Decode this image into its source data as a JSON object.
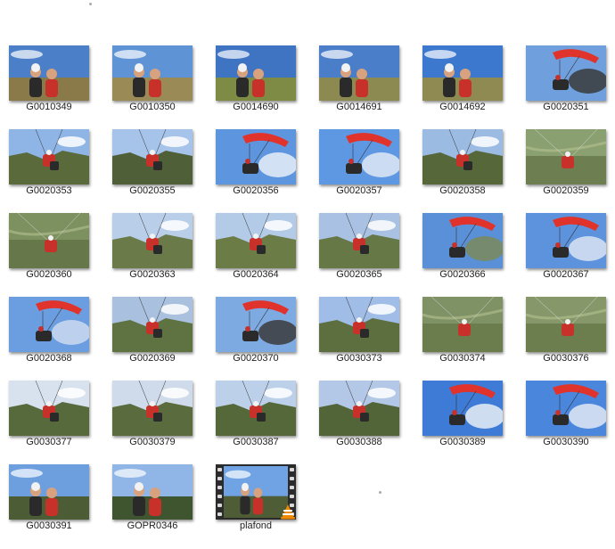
{
  "explorer": {
    "files": [
      {
        "name": "G0010349",
        "type": "image",
        "sky": "#4b7fc7",
        "ground": "#8a7a4a",
        "canopy": false,
        "scene": "people"
      },
      {
        "name": "G0010350",
        "type": "image",
        "sky": "#5e93d6",
        "ground": "#9a8a55",
        "canopy": false,
        "scene": "people"
      },
      {
        "name": "G0014690",
        "type": "image",
        "sky": "#3f74c2",
        "ground": "#7d8b45",
        "canopy": false,
        "scene": "people"
      },
      {
        "name": "G0014691",
        "type": "image",
        "sky": "#4a7ec8",
        "ground": "#8c8a50",
        "canopy": false,
        "scene": "people"
      },
      {
        "name": "G0014692",
        "type": "image",
        "sky": "#3d78cf",
        "ground": "#8f8a52",
        "canopy": false,
        "scene": "people"
      },
      {
        "name": "G0020351",
        "type": "image",
        "sky": "#6fa0dd",
        "ground": "#3a3a3a",
        "canopy": true,
        "scene": "canopy"
      },
      {
        "name": "G0020353",
        "type": "image",
        "sky": "#8fb5e6",
        "ground": "#5a6a3a",
        "canopy": false,
        "scene": "flight"
      },
      {
        "name": "G0020355",
        "type": "image",
        "sky": "#a6c4ea",
        "ground": "#4f5f38",
        "canopy": false,
        "scene": "flight"
      },
      {
        "name": "G0020356",
        "type": "image",
        "sky": "#5d95df",
        "ground": "#e8eef8",
        "canopy": true,
        "scene": "canopy"
      },
      {
        "name": "G0020357",
        "type": "image",
        "sky": "#5f98e2",
        "ground": "#dfe7f4",
        "canopy": true,
        "scene": "canopy"
      },
      {
        "name": "G0020358",
        "type": "image",
        "sky": "#9bbbe3",
        "ground": "#56673a",
        "canopy": false,
        "scene": "flight"
      },
      {
        "name": "G0020359",
        "type": "image",
        "sky": "#8aa070",
        "ground": "#6d7f50",
        "canopy": false,
        "scene": "valley"
      },
      {
        "name": "G0020360",
        "type": "image",
        "sky": "#7c9060",
        "ground": "#66784a",
        "canopy": false,
        "scene": "valley"
      },
      {
        "name": "G0020363",
        "type": "image",
        "sky": "#b9cfe9",
        "ground": "#6a7a48",
        "canopy": false,
        "scene": "flight"
      },
      {
        "name": "G0020364",
        "type": "image",
        "sky": "#b4cbe7",
        "ground": "#6b7c47",
        "canopy": false,
        "scene": "flight"
      },
      {
        "name": "G0020365",
        "type": "image",
        "sky": "#a9c2e4",
        "ground": "#657845",
        "canopy": false,
        "scene": "flight"
      },
      {
        "name": "G0020366",
        "type": "image",
        "sky": "#5a90d8",
        "ground": "#7b8a5a",
        "canopy": true,
        "scene": "canopy"
      },
      {
        "name": "G0020367",
        "type": "image",
        "sky": "#5c93dc",
        "ground": "#d9e3f2",
        "canopy": true,
        "scene": "canopy"
      },
      {
        "name": "G0020368",
        "type": "image",
        "sky": "#6a9ee0",
        "ground": "#cbd8ee",
        "canopy": true,
        "scene": "canopy"
      },
      {
        "name": "G0020369",
        "type": "image",
        "sky": "#a9c1df",
        "ground": "#5e7242",
        "canopy": false,
        "scene": "flight"
      },
      {
        "name": "G0020370",
        "type": "image",
        "sky": "#7eaae2",
        "ground": "#3b3b3b",
        "canopy": true,
        "scene": "canopy"
      },
      {
        "name": "G0030373",
        "type": "image",
        "sky": "#9fbde6",
        "ground": "#5d6e3f",
        "canopy": false,
        "scene": "flight"
      },
      {
        "name": "G0030374",
        "type": "image",
        "sky": "#7f9265",
        "ground": "#6b7d4d",
        "canopy": false,
        "scene": "valley"
      },
      {
        "name": "G0030376",
        "type": "image",
        "sky": "#86986a",
        "ground": "#6c7e4e",
        "canopy": false,
        "scene": "valley"
      },
      {
        "name": "G0030377",
        "type": "image",
        "sky": "#d8e2ef",
        "ground": "#566a3c",
        "canopy": false,
        "scene": "flight"
      },
      {
        "name": "G0030379",
        "type": "image",
        "sky": "#cfdbea",
        "ground": "#5a6b3d",
        "canopy": false,
        "scene": "flight"
      },
      {
        "name": "G0030387",
        "type": "image",
        "sky": "#bcd0ea",
        "ground": "#55683a",
        "canopy": false,
        "scene": "flight"
      },
      {
        "name": "G0030388",
        "type": "image",
        "sky": "#b2c8e6",
        "ground": "#526538",
        "canopy": false,
        "scene": "flight"
      },
      {
        "name": "G0030389",
        "type": "image",
        "sky": "#3e7bd6",
        "ground": "#e9eef6",
        "canopy": true,
        "scene": "canopy"
      },
      {
        "name": "G0030390",
        "type": "image",
        "sky": "#4a86dc",
        "ground": "#e2e9f4",
        "canopy": true,
        "scene": "canopy"
      },
      {
        "name": "G0030391",
        "type": "image",
        "sky": "#6d9fdf",
        "ground": "#4c5d35",
        "canopy": false,
        "scene": "people"
      },
      {
        "name": "GOPR0346",
        "type": "image",
        "sky": "#8fb6e6",
        "ground": "#3f5530",
        "canopy": false,
        "scene": "people"
      },
      {
        "name": "plafond",
        "type": "video",
        "sky": "#6fa3e3",
        "ground": "#4e5d35",
        "canopy": false,
        "scene": "people"
      }
    ]
  },
  "colors": {
    "canopy": "#e0332b",
    "skin": "#d9a27e",
    "jacket_red": "#c8302a",
    "dark": "#2a2a2a",
    "vlc_orange": "#f08a00"
  }
}
